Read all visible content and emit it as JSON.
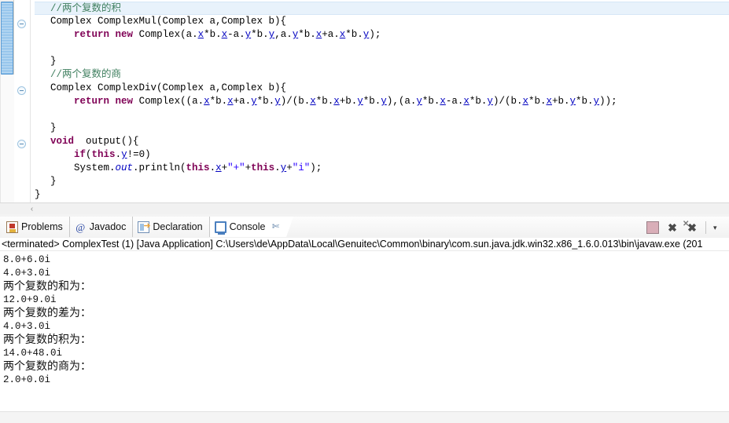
{
  "editor": {
    "lines": [
      {
        "indent": 0,
        "current": true,
        "tokens": [
          {
            "t": "//两个复数的积",
            "c": "cmt"
          }
        ]
      },
      {
        "indent": 0,
        "current": false,
        "tokens": [
          {
            "t": "Complex ComplexMul(Complex a,Complex b){",
            "c": "pln"
          }
        ]
      },
      {
        "indent": 0,
        "current": false,
        "tokens": [
          {
            "t": "    ",
            "c": "pln"
          },
          {
            "t": "return",
            "c": "kw"
          },
          {
            "t": " ",
            "c": "pln"
          },
          {
            "t": "new",
            "c": "kw"
          },
          {
            "t": " Complex(a.",
            "c": "pln"
          },
          {
            "t": "x",
            "c": "fld"
          },
          {
            "t": "*b.",
            "c": "pln"
          },
          {
            "t": "x",
            "c": "fld"
          },
          {
            "t": "-a.",
            "c": "pln"
          },
          {
            "t": "y",
            "c": "fld"
          },
          {
            "t": "*b.",
            "c": "pln"
          },
          {
            "t": "y",
            "c": "fld"
          },
          {
            "t": ",a.",
            "c": "pln"
          },
          {
            "t": "y",
            "c": "fld"
          },
          {
            "t": "*b.",
            "c": "pln"
          },
          {
            "t": "x",
            "c": "fld"
          },
          {
            "t": "+a.",
            "c": "pln"
          },
          {
            "t": "x",
            "c": "fld"
          },
          {
            "t": "*b.",
            "c": "pln"
          },
          {
            "t": "y",
            "c": "fld"
          },
          {
            "t": ");",
            "c": "pln"
          }
        ]
      },
      {
        "indent": 0,
        "current": false,
        "tokens": []
      },
      {
        "indent": 0,
        "current": false,
        "tokens": [
          {
            "t": "}",
            "c": "pln"
          }
        ]
      },
      {
        "indent": 0,
        "current": false,
        "tokens": [
          {
            "t": "//两个复数的商",
            "c": "cmt"
          }
        ]
      },
      {
        "indent": 0,
        "current": false,
        "tokens": [
          {
            "t": "Complex ComplexDiv(Complex a,Complex b){",
            "c": "pln"
          }
        ]
      },
      {
        "indent": 0,
        "current": false,
        "tokens": [
          {
            "t": "    ",
            "c": "pln"
          },
          {
            "t": "return",
            "c": "kw"
          },
          {
            "t": " ",
            "c": "pln"
          },
          {
            "t": "new",
            "c": "kw"
          },
          {
            "t": " Complex((a.",
            "c": "pln"
          },
          {
            "t": "x",
            "c": "fld"
          },
          {
            "t": "*b.",
            "c": "pln"
          },
          {
            "t": "x",
            "c": "fld"
          },
          {
            "t": "+a.",
            "c": "pln"
          },
          {
            "t": "y",
            "c": "fld"
          },
          {
            "t": "*b.",
            "c": "pln"
          },
          {
            "t": "y",
            "c": "fld"
          },
          {
            "t": ")/(b.",
            "c": "pln"
          },
          {
            "t": "x",
            "c": "fld"
          },
          {
            "t": "*b.",
            "c": "pln"
          },
          {
            "t": "x",
            "c": "fld"
          },
          {
            "t": "+b.",
            "c": "pln"
          },
          {
            "t": "y",
            "c": "fld"
          },
          {
            "t": "*b.",
            "c": "pln"
          },
          {
            "t": "y",
            "c": "fld"
          },
          {
            "t": "),(a.",
            "c": "pln"
          },
          {
            "t": "y",
            "c": "fld"
          },
          {
            "t": "*b.",
            "c": "pln"
          },
          {
            "t": "x",
            "c": "fld"
          },
          {
            "t": "-a.",
            "c": "pln"
          },
          {
            "t": "x",
            "c": "fld"
          },
          {
            "t": "*b.",
            "c": "pln"
          },
          {
            "t": "y",
            "c": "fld"
          },
          {
            "t": ")/(b.",
            "c": "pln"
          },
          {
            "t": "x",
            "c": "fld"
          },
          {
            "t": "*b.",
            "c": "pln"
          },
          {
            "t": "x",
            "c": "fld"
          },
          {
            "t": "+b.",
            "c": "pln"
          },
          {
            "t": "y",
            "c": "fld"
          },
          {
            "t": "*b.",
            "c": "pln"
          },
          {
            "t": "y",
            "c": "fld"
          },
          {
            "t": "));",
            "c": "pln"
          }
        ]
      },
      {
        "indent": 0,
        "current": false,
        "tokens": []
      },
      {
        "indent": 0,
        "current": false,
        "tokens": [
          {
            "t": "}",
            "c": "pln"
          }
        ]
      },
      {
        "indent": 0,
        "current": false,
        "tokens": [
          {
            "t": "void",
            "c": "kw"
          },
          {
            "t": "  output(){",
            "c": "pln"
          }
        ]
      },
      {
        "indent": 0,
        "current": false,
        "tokens": [
          {
            "t": "    ",
            "c": "pln"
          },
          {
            "t": "if",
            "c": "kw"
          },
          {
            "t": "(",
            "c": "pln"
          },
          {
            "t": "this",
            "c": "kw"
          },
          {
            "t": ".",
            "c": "pln"
          },
          {
            "t": "y",
            "c": "fld"
          },
          {
            "t": "!=0)",
            "c": "pln"
          }
        ]
      },
      {
        "indent": 0,
        "current": false,
        "tokens": [
          {
            "t": "    System.",
            "c": "pln"
          },
          {
            "t": "out",
            "c": "sfld"
          },
          {
            "t": ".println(",
            "c": "pln"
          },
          {
            "t": "this",
            "c": "kw"
          },
          {
            "t": ".",
            "c": "pln"
          },
          {
            "t": "x",
            "c": "fld"
          },
          {
            "t": "+",
            "c": "pln"
          },
          {
            "t": "\"+\"",
            "c": "str"
          },
          {
            "t": "+",
            "c": "pln"
          },
          {
            "t": "this",
            "c": "kw"
          },
          {
            "t": ".",
            "c": "pln"
          },
          {
            "t": "y",
            "c": "fld"
          },
          {
            "t": "+",
            "c": "pln"
          },
          {
            "t": "\"i\"",
            "c": "str"
          },
          {
            "t": ");",
            "c": "pln"
          }
        ]
      },
      {
        "indent": 0,
        "current": false,
        "tokens": [
          {
            "t": "}",
            "c": "pln"
          }
        ]
      },
      {
        "indent": -1,
        "current": false,
        "tokens": [
          {
            "t": "}",
            "c": "pln"
          }
        ]
      }
    ],
    "fold_markers_y": [
      25,
      110,
      178
    ],
    "hscroll_left_arrow": "‹"
  },
  "tabbar": {
    "tabs": [
      {
        "label": "Problems",
        "icon": "problems-icon",
        "active": false,
        "closable": false
      },
      {
        "label": "Javadoc",
        "icon": "javadoc-icon",
        "active": false,
        "closable": false,
        "glyph": "@"
      },
      {
        "label": "Declaration",
        "icon": "declaration-icon",
        "active": false,
        "closable": false
      },
      {
        "label": "Console",
        "icon": "console-icon",
        "active": true,
        "closable": true,
        "close_glyph": "✄"
      }
    ],
    "toolbar": [
      {
        "name": "terminate-button",
        "icon": "stop-icon",
        "glyph": ""
      },
      {
        "name": "remove-launch-button",
        "icon": "remove-x-icon",
        "glyph": "✖"
      },
      {
        "name": "remove-all-button",
        "icon": "remove-all-x-icon",
        "glyph": "✖"
      }
    ]
  },
  "console": {
    "header": "<terminated> ComplexTest (1) [Java Application] C:\\Users\\de\\AppData\\Local\\Genuitec\\Common\\binary\\com.sun.java.jdk.win32.x86_1.6.0.013\\bin\\javaw.exe (201",
    "output": [
      {
        "text": "8.0+6.0i",
        "cjk": false
      },
      {
        "text": "4.0+3.0i",
        "cjk": false
      },
      {
        "text": "两个复数的和为：",
        "cjk": true
      },
      {
        "text": "12.0+9.0i",
        "cjk": false
      },
      {
        "text": "两个复数的差为：",
        "cjk": true
      },
      {
        "text": "4.0+3.0i",
        "cjk": false
      },
      {
        "text": "两个复数的积为：",
        "cjk": true
      },
      {
        "text": "14.0+48.0i",
        "cjk": false
      },
      {
        "text": "两个复数的商为：",
        "cjk": true
      },
      {
        "text": "2.0+0.0i",
        "cjk": false
      }
    ]
  },
  "colors": {
    "comment": "#3f7f5f",
    "keyword": "#7f0055",
    "field": "#0000c0",
    "string": "#2a00ff",
    "current_line": "#e8f2fb",
    "scrollbar_thumb": "#9fcdf0"
  }
}
